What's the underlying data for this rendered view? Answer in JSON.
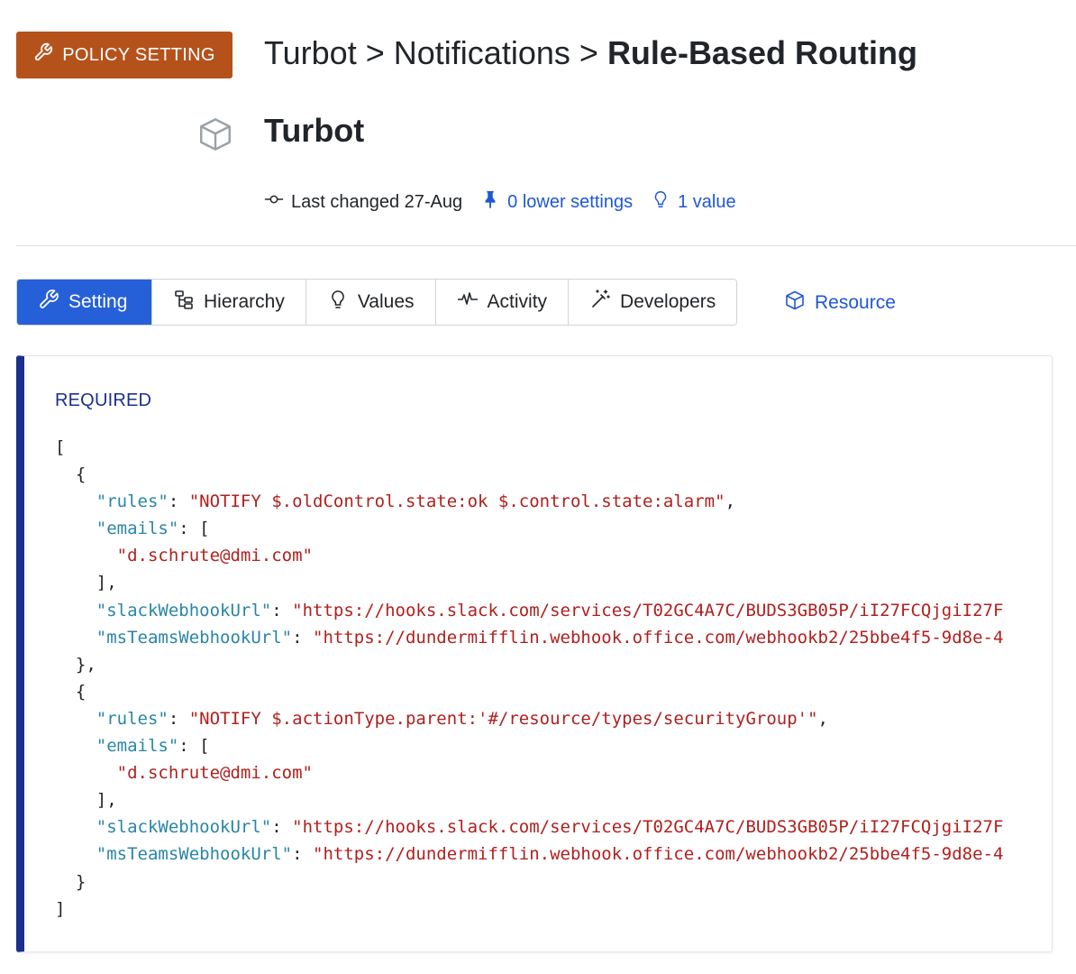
{
  "badge": {
    "label": "POLICY SETTING"
  },
  "breadcrumb": {
    "part1": "Turbot",
    "sep": ">",
    "part2": "Notifications",
    "part3": "Rule-Based Routing"
  },
  "resource": {
    "title": "Turbot"
  },
  "meta": {
    "last_changed": "Last changed 27-Aug",
    "lower_settings": "0 lower settings",
    "values": "1 value"
  },
  "tabs": [
    {
      "label": "Setting",
      "icon": "wrench-icon",
      "active": true
    },
    {
      "label": "Hierarchy",
      "icon": "hierarchy-icon",
      "active": false
    },
    {
      "label": "Values",
      "icon": "lightbulb-icon",
      "active": false
    },
    {
      "label": "Activity",
      "icon": "activity-icon",
      "active": false
    },
    {
      "label": "Developers",
      "icon": "wand-icon",
      "active": false
    }
  ],
  "resource_link": {
    "label": "Resource",
    "icon": "cube-icon"
  },
  "panel": {
    "label": "REQUIRED"
  },
  "code": {
    "lines": [
      "[",
      "  {",
      "    \"rules\": \"NOTIFY $.oldControl.state:ok $.control.state:alarm\",",
      "    \"emails\": [",
      "      \"d.schrute@dmi.com\"",
      "    ],",
      "    \"slackWebhookUrl\": \"https://hooks.slack.com/services/T02GC4A7C/BUDS3GB05P/iI27FCQjgiI27F",
      "    \"msTeamsWebhookUrl\": \"https://dundermifflin.webhook.office.com/webhookb2/25bbe4f5-9d8e-4",
      "  },",
      "  {",
      "    \"rules\": \"NOTIFY $.actionType.parent:'#/resource/types/securityGroup'\",",
      "    \"emails\": [",
      "      \"d.schrute@dmi.com\"",
      "    ],",
      "    \"slackWebhookUrl\": \"https://hooks.slack.com/services/T02GC4A7C/BUDS3GB05P/iI27FCQjgiI27F",
      "    \"msTeamsWebhookUrl\": \"https://dundermifflin.webhook.office.com/webhookb2/25bbe4f5-9d8e-4",
      "  }",
      "]"
    ]
  },
  "colors": {
    "badge_bg": "#b5521b",
    "accent_blue": "#2660d9",
    "link_blue": "#1f57d6",
    "panel_border": "#1b2f8c",
    "json_key": "#2a86a4",
    "json_string": "#b0201e"
  }
}
